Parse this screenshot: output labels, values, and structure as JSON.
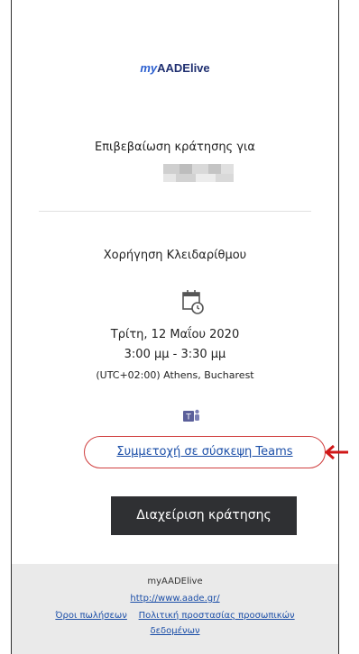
{
  "brand": {
    "prefix": "my",
    "name": "AADElive"
  },
  "booking": {
    "confirmation_label": "Επιβεβαίωση κράτησης για",
    "service": "Χορήγηση Κλειδαρίθμου",
    "date": "Τρίτη, 12 Μαΐου 2020",
    "time": "3:00 μμ - 3:30 μμ",
    "timezone": "(UTC+02:00) Athens, Bucharest"
  },
  "meeting": {
    "join_label": "Συμμετοχή σε σύσκεψη Teams"
  },
  "actions": {
    "manage_label": "Διαχείριση κράτησης"
  },
  "footer": {
    "org": "myAADElive",
    "url": "http://www.aade.gr/",
    "terms": "Όροι πωλήσεων",
    "privacy_line1": "Πολιτική προστασίας προσωπικών",
    "privacy_line2": "δεδομένων"
  },
  "icons": {
    "calendar": "calendar-clock-icon",
    "teams": "teams-icon",
    "arrow": "arrow-left-icon"
  },
  "colors": {
    "link": "#1c4fa8",
    "highlight": "#d04040",
    "button": "#2f3033"
  }
}
